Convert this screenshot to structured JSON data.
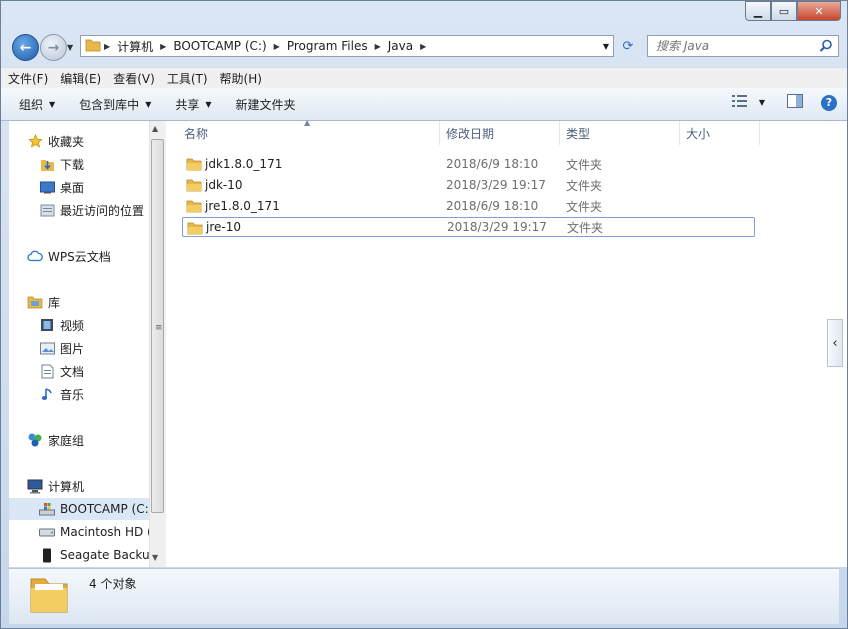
{
  "window": {
    "controls": {
      "minimize": "▁",
      "maximize": "▭",
      "close": "✕"
    }
  },
  "address": {
    "crumbs": [
      "计算机",
      "BOOTCAMP (C:)",
      "Program Files",
      "Java"
    ],
    "search_placeholder": "搜索 Java"
  },
  "menu": [
    "文件(F)",
    "编辑(E)",
    "查看(V)",
    "工具(T)",
    "帮助(H)"
  ],
  "toolbar": {
    "organize": "组织",
    "include_in_library": "包含到库中",
    "share": "共享",
    "new_folder": "新建文件夹",
    "help": "?"
  },
  "nav": {
    "favorites": "收藏夹",
    "downloads": "下载",
    "desktop": "桌面",
    "recent": "最近访问的位置",
    "wps": "WPS云文档",
    "libraries": "库",
    "videos": "视频",
    "pictures": "图片",
    "documents": "文档",
    "music": "音乐",
    "homegroup": "家庭组",
    "computer": "计算机",
    "bootcamp": "BOOTCAMP (C:)",
    "macintosh": "Macintosh HD (",
    "seagate": "Seagate Backup"
  },
  "columns": {
    "name": "名称",
    "date": "修改日期",
    "type": "类型",
    "size": "大小"
  },
  "files": [
    {
      "name": "jdk1.8.0_171",
      "date": "2018/6/9 18:10",
      "type": "文件夹"
    },
    {
      "name": "jdk-10",
      "date": "2018/3/29 19:17",
      "type": "文件夹"
    },
    {
      "name": "jre1.8.0_171",
      "date": "2018/6/9 18:10",
      "type": "文件夹"
    },
    {
      "name": "jre-10",
      "date": "2018/3/29 19:17",
      "type": "文件夹"
    }
  ],
  "status": {
    "count": "4 个对象"
  },
  "colors": {
    "accent": "#2c6fc6",
    "folder": "#e8b84a",
    "selection": "#dae7f6"
  }
}
